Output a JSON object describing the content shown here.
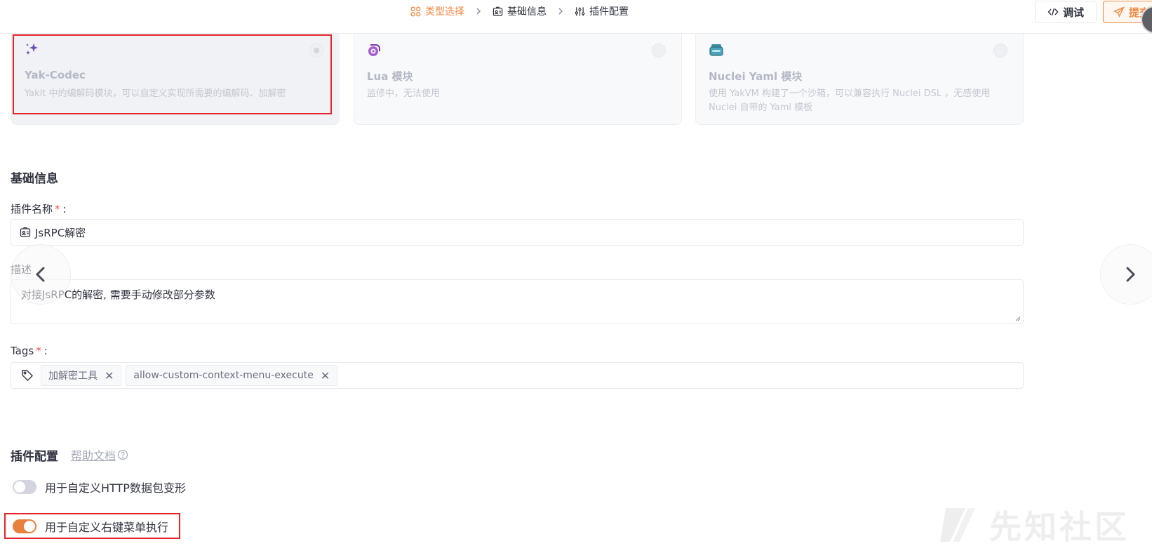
{
  "steps": [
    {
      "label": "类型选择",
      "icon": "grid-icon",
      "active": true
    },
    {
      "label": "基础信息",
      "icon": "id-card-icon",
      "active": false
    },
    {
      "label": "插件配置",
      "icon": "sliders-icon",
      "active": false
    }
  ],
  "toolbar": {
    "debug_label": "调试",
    "submit_label": "提交"
  },
  "cards": [
    {
      "title": "Yak-Codec",
      "desc": "Yakit 中的编解码模块，可以自定义实现所需要的编解码、加解密",
      "icon": "sparkles-icon",
      "selected": true
    },
    {
      "title": "Lua 模块",
      "desc": "监修中，无法使用",
      "icon": "lua-icon",
      "selected": false
    },
    {
      "title": "Nuclei Yaml 模块",
      "desc": "使用 YakVM 构建了一个沙箱，可以兼容执行 Nuclei DSL ，无感使用 Nuclei 自带的 Yaml 模板",
      "icon": "nuclei-icon",
      "selected": false
    }
  ],
  "basic": {
    "title": "基础信息",
    "name_label": "插件名称",
    "name_value": "JsRPC解密",
    "desc_label": "描述",
    "desc_value": "对接JsRPC的解密, 需要手动修改部分参数",
    "tags_label": "Tags",
    "colon": ":",
    "required_mark": "*",
    "tags": [
      "加解密工具",
      "allow-custom-context-menu-execute"
    ]
  },
  "config": {
    "title": "插件配置",
    "help_label": "帮助文档",
    "switches": [
      {
        "label": "用于自定义HTTP数据包变形",
        "on": false
      },
      {
        "label": "用于自定义右键菜单执行",
        "on": true
      }
    ]
  },
  "watermark": "先知社区",
  "colors": {
    "accent": "#f28b44",
    "highlight": "#e5262b",
    "switch_on": "#e8803e"
  }
}
